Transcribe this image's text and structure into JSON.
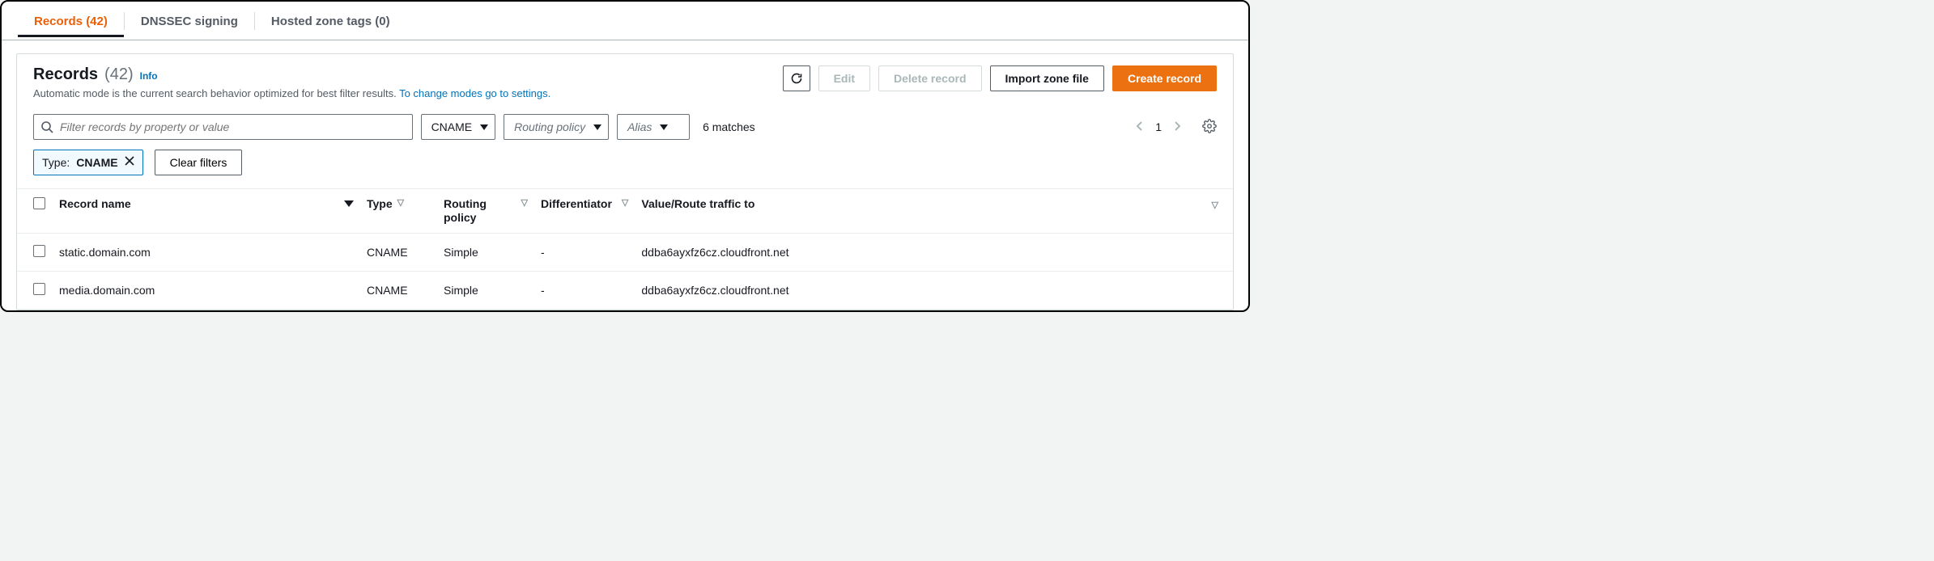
{
  "tabs": [
    {
      "label": "Records (42)",
      "active": true
    },
    {
      "label": "DNSSEC signing",
      "active": false
    },
    {
      "label": "Hosted zone tags (0)",
      "active": false
    }
  ],
  "panel": {
    "title": "Records",
    "count": "(42)",
    "info": "Info",
    "subtitle_plain": "Automatic mode is the current search behavior optimized for best filter results. ",
    "subtitle_link": "To change modes go to settings."
  },
  "actions": {
    "refresh_icon": "refresh",
    "edit": "Edit",
    "delete": "Delete record",
    "import": "Import zone file",
    "create": "Create record"
  },
  "filters": {
    "search_placeholder": "Filter records by property or value",
    "type_value": "CNAME",
    "routing_placeholder": "Routing policy",
    "alias_placeholder": "Alias",
    "matches": "6 matches",
    "page": "1"
  },
  "chips": {
    "type_label": "Type: ",
    "type_value": "CNAME",
    "clear": "Clear filters"
  },
  "columns": {
    "name": "Record name",
    "type": "Type",
    "policy": "Routing policy",
    "diff": "Differentiator",
    "value": "Value/Route traffic to"
  },
  "rows": [
    {
      "name": "static.domain.com",
      "type": "CNAME",
      "policy": "Simple",
      "diff": "-",
      "value": "ddba6ayxfz6cz.cloudfront.net"
    },
    {
      "name": "media.domain.com",
      "type": "CNAME",
      "policy": "Simple",
      "diff": "-",
      "value": "ddba6ayxfz6cz.cloudfront.net"
    }
  ]
}
